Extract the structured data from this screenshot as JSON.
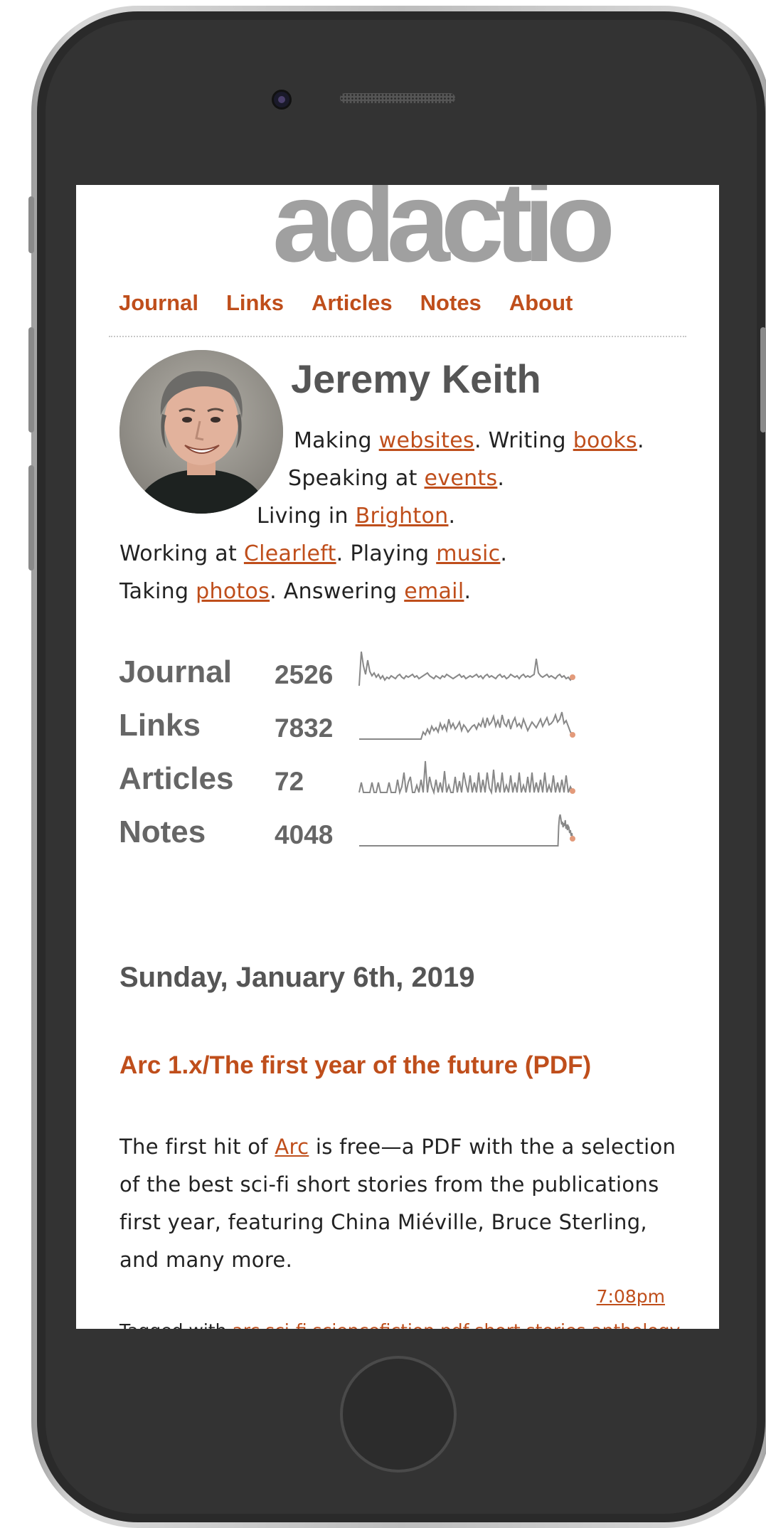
{
  "site": {
    "logo": "adactio"
  },
  "nav": [
    {
      "label": "Journal"
    },
    {
      "label": "Links"
    },
    {
      "label": "Articles"
    },
    {
      "label": "Notes"
    },
    {
      "label": "About"
    }
  ],
  "profile": {
    "name": "Jeremy Keith",
    "bio": [
      {
        "parts": [
          {
            "t": "Making "
          },
          {
            "t": "websites",
            "link": true
          },
          {
            "t": ". Writing "
          },
          {
            "t": "books",
            "link": true
          },
          {
            "t": "."
          }
        ]
      },
      {
        "parts": [
          {
            "t": "Speaking at "
          },
          {
            "t": "events",
            "link": true
          },
          {
            "t": "."
          }
        ]
      },
      {
        "parts": [
          {
            "t": "Living in "
          },
          {
            "t": "Brighton",
            "link": true
          },
          {
            "t": "."
          }
        ]
      },
      {
        "parts": [
          {
            "t": "Working at "
          },
          {
            "t": "Clearleft",
            "link": true
          },
          {
            "t": ". Playing "
          },
          {
            "t": "music",
            "link": true
          },
          {
            "t": "."
          }
        ]
      },
      {
        "parts": [
          {
            "t": "Taking "
          },
          {
            "t": "photos",
            "link": true
          },
          {
            "t": ". Answering "
          },
          {
            "t": "email",
            "link": true
          },
          {
            "t": "."
          }
        ]
      }
    ]
  },
  "stats": [
    {
      "label": "Journal",
      "count": "2526"
    },
    {
      "label": "Links",
      "count": "7832"
    },
    {
      "label": "Articles",
      "count": "72"
    },
    {
      "label": "Notes",
      "count": "4048"
    }
  ],
  "sparklines": {
    "Journal": [
      58,
      10,
      30,
      42,
      22,
      38,
      44,
      40,
      46,
      42,
      48,
      44,
      50,
      46,
      48,
      44,
      46,
      48,
      44,
      42,
      46,
      48,
      44,
      46,
      44,
      42,
      46,
      44,
      48,
      46,
      44,
      42,
      40,
      44,
      46,
      48,
      44,
      46,
      48,
      44,
      46,
      42,
      44,
      46,
      48,
      46,
      44,
      42,
      46,
      44,
      48,
      46,
      44,
      46,
      44,
      42,
      46,
      44,
      48,
      44,
      42,
      46,
      44,
      46,
      48,
      44,
      42,
      46,
      44,
      48,
      46,
      42,
      44,
      46,
      44,
      48,
      44,
      42,
      46,
      44,
      46,
      44,
      42,
      20,
      40,
      44,
      46,
      44,
      42,
      46,
      44,
      46,
      48,
      44,
      42,
      46,
      44,
      48,
      46,
      50,
      46
    ],
    "Links": [
      58,
      58,
      58,
      58,
      58,
      58,
      58,
      58,
      58,
      58,
      58,
      58,
      58,
      58,
      58,
      58,
      58,
      58,
      58,
      58,
      58,
      58,
      58,
      58,
      58,
      58,
      58,
      58,
      58,
      58,
      48,
      52,
      44,
      50,
      40,
      46,
      42,
      48,
      36,
      44,
      38,
      46,
      30,
      42,
      36,
      44,
      40,
      34,
      46,
      38,
      42,
      48,
      44,
      40,
      38,
      44,
      36,
      40,
      30,
      42,
      28,
      38,
      34,
      26,
      40,
      32,
      42,
      24,
      36,
      40,
      30,
      44,
      34,
      28,
      40,
      36,
      42,
      30,
      38,
      46,
      40,
      34,
      38,
      42,
      36,
      30,
      40,
      34,
      28,
      38,
      36,
      32,
      24,
      34,
      30,
      20,
      36,
      32,
      40,
      48,
      52
    ],
    "Articles": [
      58,
      44,
      58,
      58,
      58,
      58,
      44,
      58,
      58,
      44,
      58,
      58,
      58,
      58,
      44,
      58,
      58,
      58,
      40,
      58,
      50,
      30,
      58,
      44,
      36,
      58,
      58,
      48,
      58,
      40,
      58,
      14,
      58,
      36,
      50,
      58,
      40,
      58,
      44,
      58,
      28,
      58,
      48,
      58,
      58,
      36,
      58,
      42,
      58,
      30,
      46,
      58,
      34,
      58,
      44,
      58,
      30,
      58,
      40,
      58,
      30,
      52,
      58,
      26,
      58,
      44,
      58,
      30,
      58,
      48,
      58,
      34,
      58,
      44,
      58,
      30,
      58,
      48,
      58,
      36,
      58,
      30,
      58,
      44,
      58,
      40,
      58,
      30,
      58,
      48,
      58,
      34,
      58,
      44,
      58,
      40,
      58,
      34,
      58,
      50,
      56
    ],
    "Notes": [
      58,
      58,
      58,
      58,
      58,
      58,
      58,
      58,
      58,
      58,
      58,
      58,
      58,
      58,
      58,
      58,
      58,
      58,
      58,
      58,
      58,
      58,
      58,
      58,
      58,
      58,
      58,
      58,
      58,
      58,
      58,
      58,
      58,
      58,
      58,
      58,
      58,
      58,
      58,
      58,
      58,
      58,
      58,
      58,
      58,
      58,
      58,
      58,
      58,
      58,
      58,
      58,
      58,
      58,
      58,
      58,
      58,
      58,
      58,
      58,
      58,
      58,
      58,
      58,
      58,
      58,
      58,
      58,
      58,
      58,
      58,
      58,
      58,
      58,
      58,
      58,
      58,
      58,
      58,
      58,
      58,
      58,
      58,
      58,
      58,
      58,
      58,
      58,
      58,
      58,
      58,
      58,
      58,
      58,
      58,
      58,
      58,
      58,
      58,
      58,
      58,
      58,
      58,
      58,
      58,
      58,
      58,
      58,
      58,
      58,
      58,
      58,
      58,
      58,
      58,
      58,
      58,
      58,
      58,
      58,
      58,
      58,
      58,
      58,
      58,
      58,
      58,
      58,
      58,
      58,
      58,
      58,
      58,
      58,
      58,
      58,
      58,
      58,
      58,
      58,
      58,
      58,
      58,
      58,
      58,
      58,
      58,
      58,
      58,
      58,
      58,
      58,
      58,
      58,
      58,
      58,
      58,
      58,
      58,
      58,
      58,
      58,
      58,
      58,
      58,
      58,
      58,
      58,
      58,
      58,
      58,
      58,
      58,
      58,
      58,
      58,
      58,
      58,
      58,
      58,
      58,
      58,
      58,
      58,
      58,
      58,
      58,
      58,
      58,
      58,
      58,
      58,
      58,
      58,
      58,
      58,
      58,
      58,
      58,
      58,
      58,
      58,
      58,
      58,
      58,
      58,
      58,
      58,
      58,
      58,
      58,
      58,
      58,
      58,
      58,
      58,
      58,
      58,
      58,
      58,
      58,
      58,
      58,
      58,
      58,
      58,
      58,
      58,
      58,
      58,
      58,
      58,
      58,
      58,
      58,
      58,
      58,
      58,
      58,
      58,
      58,
      58,
      58,
      58,
      58,
      58,
      58,
      58,
      58,
      58,
      58,
      58,
      58,
      58,
      58,
      58,
      58,
      58,
      58,
      58,
      58,
      58,
      58,
      58,
      58,
      58,
      58,
      58,
      58,
      58,
      58,
      58,
      58,
      58,
      30,
      18,
      14,
      20,
      28,
      24,
      32,
      26,
      30,
      22,
      34,
      28,
      36,
      30,
      32,
      40,
      36,
      44,
      40,
      48
    ]
  },
  "post": {
    "date": "Sunday, January 6th, 2019",
    "title": "Arc 1.x/The first year of the future (PDF)",
    "body_before": "The first hit of ",
    "body_link": "Arc",
    "body_after": " is free—a PDF with the a selection of the best sci-fi short stories from the publications first year, featuring China Miéville, Bruce Sterling, and many more.",
    "time": "7:08pm",
    "tagged_label": "Tagged with ",
    "tags": "arc sci-fi sciencefiction pdf short stories anthology"
  },
  "colors": {
    "accent": "#bf4e1b",
    "logo": "#a0a0a0",
    "text": "#222222",
    "heading": "#555555"
  }
}
